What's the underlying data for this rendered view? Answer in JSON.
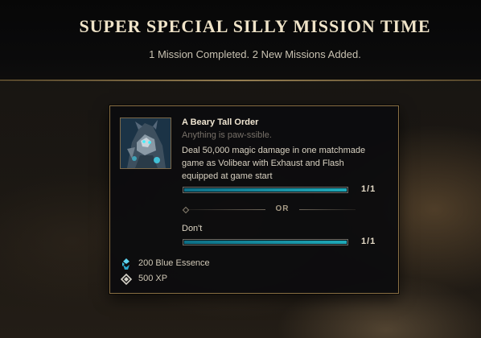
{
  "header": {
    "title": "SUPER SPECIAL SILLY MISSION TIME",
    "subtitle": "1 Mission Completed. 2 New Missions Added."
  },
  "mission": {
    "portrait_icon": "volibear-portrait-icon",
    "name": "A Beary Tall Order",
    "flavor": "Anything is paw-ssible.",
    "description": "Deal 50,000 magic damage in one matchmade game as Volibear with Exhaust and Flash equipped at game start",
    "objectives": [
      {
        "label": "",
        "progress": 1.0,
        "count": "1/1"
      },
      {
        "label": "Don't",
        "progress": 1.0,
        "count": "1/1"
      }
    ],
    "separator": "OR",
    "rewards": [
      {
        "icon": "blue-essence-icon",
        "label": "200 Blue Essence"
      },
      {
        "icon": "xp-icon",
        "label": "500 XP"
      }
    ]
  },
  "colors": {
    "gold_border": "#8a7044",
    "progress_fill": "#1fa9b8",
    "title_text": "#efe3c8"
  }
}
